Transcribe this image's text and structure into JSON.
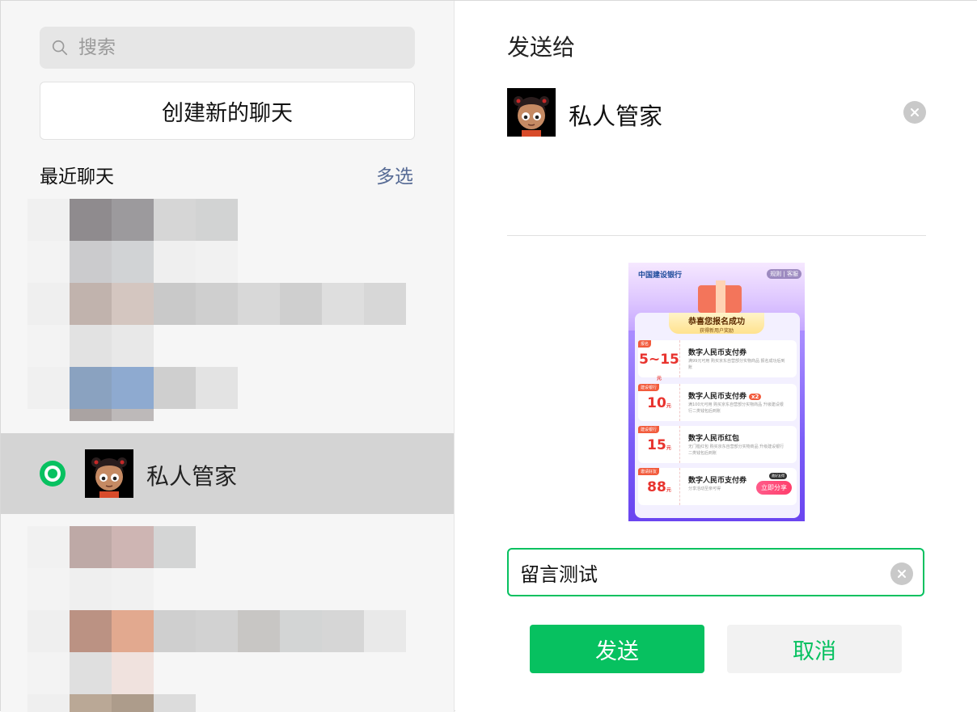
{
  "search": {
    "placeholder": "搜索",
    "icon": "search-icon"
  },
  "new_chat": {
    "label": "创建新的聊天"
  },
  "recent": {
    "title": "最近聊天",
    "multi_select": "多选"
  },
  "selected_contact": {
    "name": "私人管家",
    "selected": true
  },
  "right": {
    "title": "发送给",
    "recipient_name": "私人管家",
    "message_value": "留言测试",
    "send_label": "发送",
    "cancel_label": "取消"
  },
  "preview": {
    "bank_name": "中国建设银行",
    "top_links": "规则 | 客服",
    "banner_title": "恭喜您报名成功",
    "banner_sub": "获得新用户奖励",
    "coupons": [
      {
        "tag": "报名",
        "amount": "5~15",
        "unit": "元",
        "title": "数字人民币支付券",
        "badge": "",
        "desc": "满99元可用 购买京东自营部分实物商品 报名成功后到账"
      },
      {
        "tag": "建设银行",
        "amount": "10",
        "unit": "元",
        "title": "数字人民币支付券",
        "badge": "x2",
        "desc": "满100元可用 购买京东自营部分实物商品 升级建设银行二类钱包后到账"
      },
      {
        "tag": "建设银行",
        "amount": "15",
        "unit": "元",
        "title": "数字人民币红包",
        "badge": "",
        "desc": "无门槛红包 购买京东自营部分实物商品 升级建设银行二类钱包后到账"
      },
      {
        "tag": "邀请好友",
        "amount": "88",
        "unit": "元",
        "title": "数字人民币支付券",
        "badge": "",
        "desc": "分享活动至亲可得",
        "share_tag": "邀好友得",
        "share": "立即分享"
      }
    ]
  },
  "colors": {
    "accent": "#07c160",
    "link": "#576b95",
    "selected_row": "#d4d4d4",
    "sidebar_bg": "#f6f6f6"
  }
}
